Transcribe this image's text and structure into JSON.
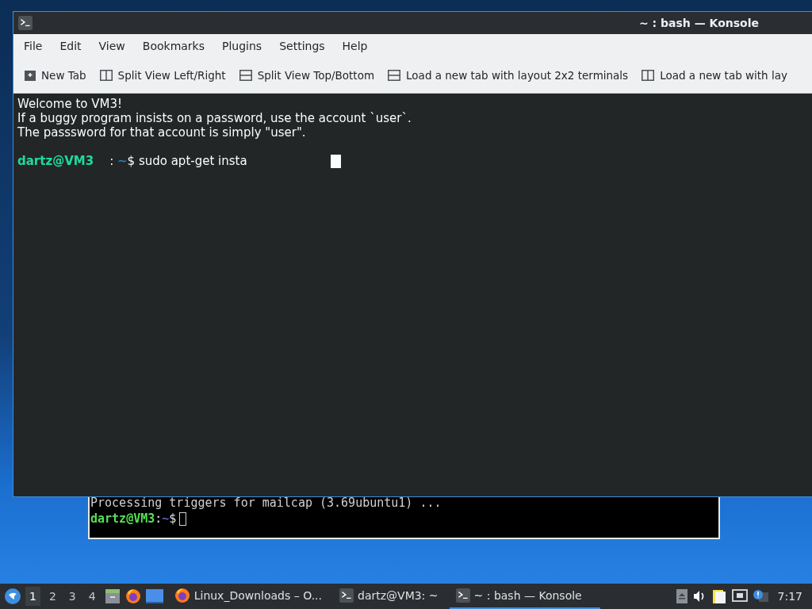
{
  "konsole": {
    "title": "~ : bash — Konsole",
    "menu": [
      "File",
      "Edit",
      "View",
      "Bookmarks",
      "Plugins",
      "Settings",
      "Help"
    ],
    "toolbar": [
      {
        "label": "New Tab",
        "kind": "newtab"
      },
      {
        "label": "Split View Left/Right",
        "kind": "vsplit"
      },
      {
        "label": "Split View Top/Bottom",
        "kind": "hsplit"
      },
      {
        "label": "Load a new tab with layout 2x2 terminals",
        "kind": "hsplit"
      },
      {
        "label": "Load a new tab with lay",
        "kind": "vsplit"
      }
    ],
    "lines": [
      "Welcome to VM3!",
      "If a buggy program insists on a password, use the account `user`.",
      "The passsword for that account is simply \"user\"."
    ],
    "prompt": {
      "user": "dartz@VM3",
      "sep": ":",
      "path": "~",
      "symbol": "$",
      "command": "sudo apt-get insta"
    }
  },
  "back_terminal": {
    "lines": [
      "Processing triggers for mailcap (3.69ubuntu1) ..."
    ],
    "prompt": {
      "user": "dartz@VM3",
      "sep": ":",
      "path": "~",
      "symbol": "$"
    }
  },
  "taskbar": {
    "workspaces": [
      {
        "label": "1",
        "selected": true
      },
      {
        "label": "2",
        "selected": false
      },
      {
        "label": "3",
        "selected": false
      },
      {
        "label": "4",
        "selected": false
      }
    ],
    "tasks": [
      {
        "label": "Linux_Downloads – O...",
        "kind": "browser",
        "selected": false
      },
      {
        "label": "dartz@VM3: ~",
        "kind": "terminal",
        "selected": false
      },
      {
        "label": "~ : bash — Konsole",
        "kind": "terminal",
        "selected": true
      }
    ],
    "clock": "7:17"
  }
}
